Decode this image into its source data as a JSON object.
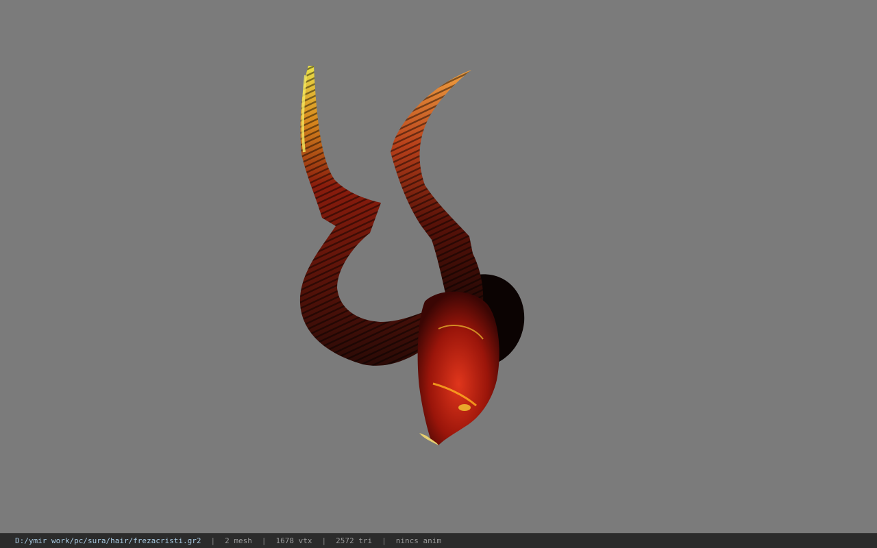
{
  "viewer": {
    "background_color": "#7b7b7b",
    "model": {
      "subject": "horned demon helmet"
    }
  },
  "status_bar": {
    "file_path": "D:/ymir work/pc/sura/hair/frezacristi.gr2",
    "separator": "|",
    "mesh_count": "2 mesh",
    "vertex_count": "1678 vtx",
    "triangle_count": "2572 tri",
    "animation": "nincs anim"
  }
}
